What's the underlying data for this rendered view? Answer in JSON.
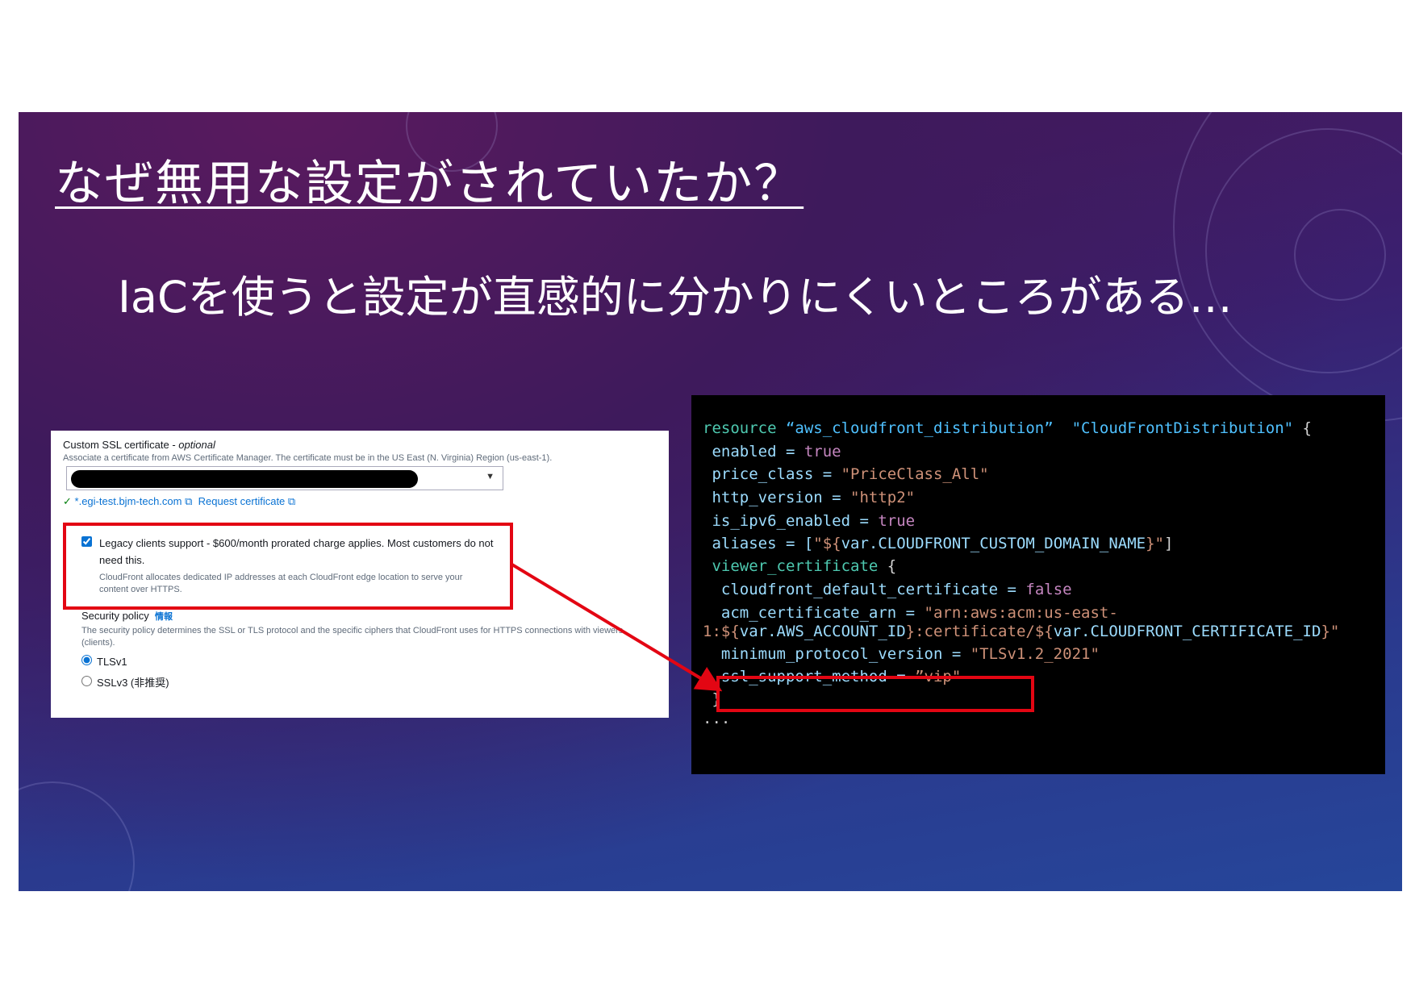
{
  "slide": {
    "title": "なぜ無用な設定がされていたか？",
    "subtitle": "IaCを使うと設定が直感的に分かりにくいところがある…"
  },
  "console": {
    "cert_label": "Custom SSL certificate - ",
    "cert_optional": "optional",
    "cert_desc": "Associate a certificate from AWS Certificate Manager. The certificate must be in the US East (N. Virginia) Region (us-east-1).",
    "cert_domain": "*.egi-test.bjm-tech.com",
    "request_cert": "Request certificate",
    "legacy_label": "Legacy clients support - $600/month prorated charge applies. Most customers do not need this.",
    "legacy_checked": true,
    "legacy_desc": "CloudFront allocates dedicated IP addresses at each CloudFront edge location to serve your content over HTTPS.",
    "security_policy": "Security policy",
    "info": "情報",
    "security_desc": "The security policy determines the SSL or TLS protocol and the specific ciphers that CloudFront uses for HTTPS connections with viewers (clients).",
    "options": [
      {
        "label": "TLSv1",
        "selected": true
      },
      {
        "label": "SSLv3 (非推奨)",
        "selected": false
      }
    ]
  },
  "code": {
    "l1a": "resource",
    "l1b": " “aws_cloudfront_distribution”  ",
    "l1c": "\"CloudFrontDistribution\"",
    "l1d": " {",
    "l2a": " enabled = ",
    "l2b": "true",
    "l3a": " price_class = ",
    "l3b": "\"PriceClass_All\"",
    "l4a": " http_version = ",
    "l4b": "\"http2\"",
    "l5a": " is_ipv6_enabled = ",
    "l5b": "true",
    "l6a": " aliases = [",
    "l6b": "\"${",
    "l6c": "var.CLOUDFRONT_CUSTOM_DOMAIN_NAME",
    "l6d": "}\"",
    "l6e": "]",
    "l7a": " viewer_certificate",
    "l7b": " {",
    "l8a": "  cloudfront_default_certificate = ",
    "l8b": "false",
    "l9a": "  acm_certificate_arn = ",
    "l9b": "\"arn:aws:acm:us-east-",
    "l10a": "1:${",
    "l10b": "var.AWS_ACCOUNT_ID",
    "l10c": "}:certificate/${",
    "l10d": "var.CLOUDFRONT_CERTIFICATE_ID",
    "l10e": "}\"",
    "l11a": "  minimum_protocol_version = ",
    "l11b": "\"TLSv1.2_2021\"",
    "l12a": "  ssl_support_method = ",
    "l12b": "”vip\"",
    "l13": " }",
    "l14": "..."
  },
  "colors": {
    "highlight": "#e30613",
    "keyword": "#4ec9b0",
    "string": "#ce9178",
    "link": "#0972d3"
  }
}
